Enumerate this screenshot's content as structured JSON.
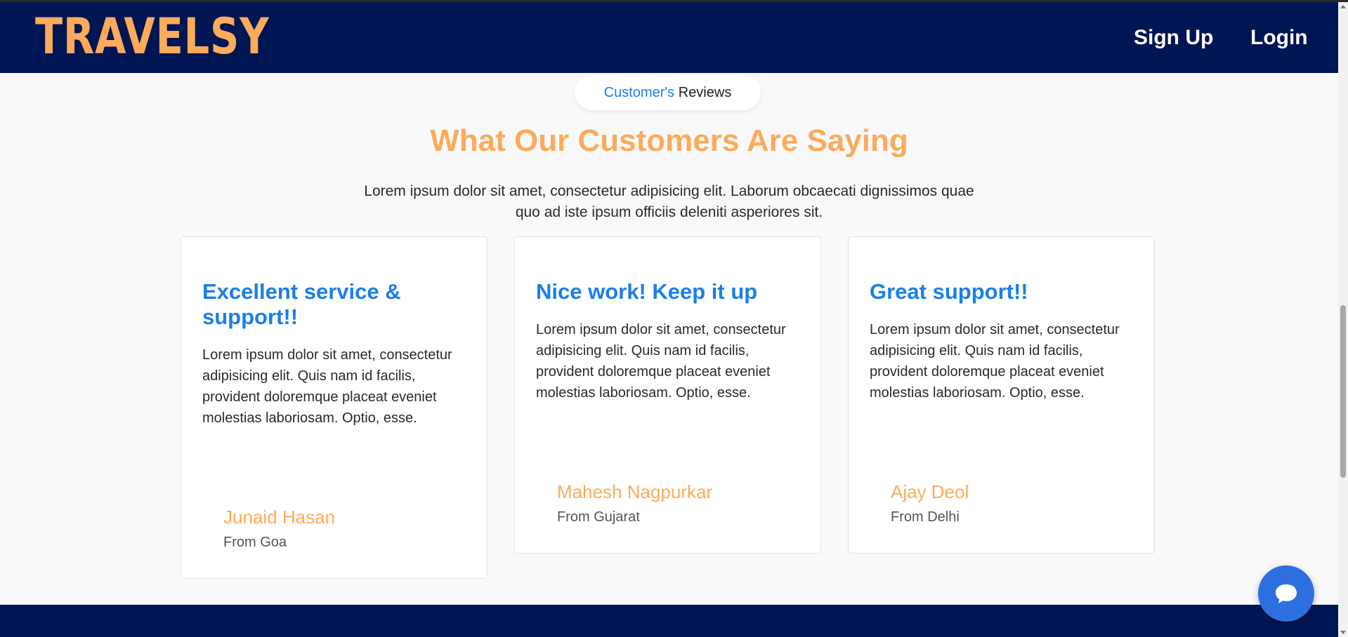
{
  "header": {
    "logo_text": "TRAVELSY",
    "signup_label": "Sign Up",
    "login_label": "Login"
  },
  "section": {
    "pill_accent": "Customer's",
    "pill_rest": " Reviews",
    "heading": "What Our Customers Are Saying",
    "intro": "Lorem ipsum dolor sit amet, consectetur adipisicing elit. Laborum obcaecati dignissimos quae quo ad iste ipsum officiis deleniti asperiores sit."
  },
  "reviews": [
    {
      "title": "Excellent service & support!!",
      "text": "Lorem ipsum dolor sit amet, consectetur adipisicing elit. Quis nam id facilis, provident doloremque placeat eveniet molestias laboriosam. Optio, esse.",
      "name": "Junaid Hasan",
      "from": "From Goa"
    },
    {
      "title": "Nice work! Keep it up",
      "text": "Lorem ipsum dolor sit amet, consectetur adipisicing elit. Quis nam id facilis, provident doloremque placeat eveniet molestias laboriosam. Optio, esse.",
      "name": "Mahesh Nagpurkar",
      "from": "From Gujarat"
    },
    {
      "title": "Great support!!",
      "text": "Lorem ipsum dolor sit amet, consectetur adipisicing elit. Quis nam id facilis, provident doloremque placeat eveniet molestias laboriosam. Optio, esse.",
      "name": "Ajay Deol",
      "from": "From Delhi"
    }
  ],
  "chat": {
    "icon": "chat-bubble-icon"
  },
  "colors": {
    "navy": "#001554",
    "orange": "#fcab5a",
    "blue": "#1b7fe8",
    "chat_blue": "#2e6fe0"
  }
}
